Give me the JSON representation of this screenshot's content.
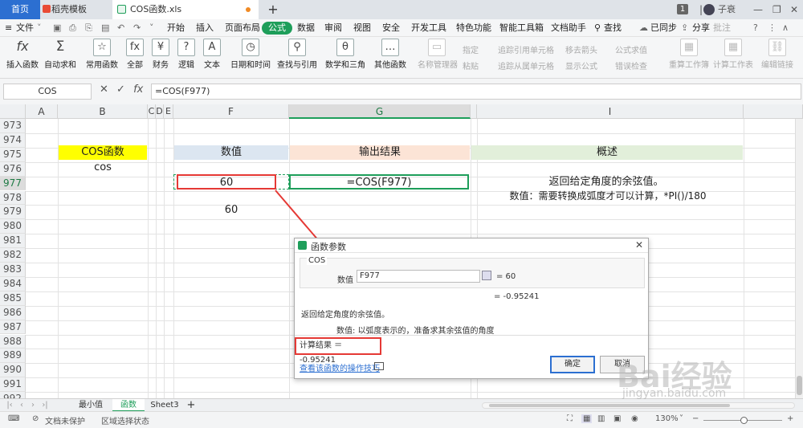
{
  "titlebar": {
    "home_tab": "首页",
    "template_tab": "稻壳模板",
    "file_tab": "COS函数.xls",
    "page_badge": "1",
    "user_name": "子衰"
  },
  "menubar": {
    "file_menu": "文件",
    "items": [
      "开始",
      "插入",
      "页面布局",
      "公式",
      "数据",
      "审阅",
      "视图",
      "安全",
      "开发工具",
      "特色功能",
      "智能工具箱",
      "文档助手"
    ],
    "search": "查找",
    "sync": "已同步",
    "share": "分享",
    "annotate": "批注"
  },
  "ribbon": {
    "insert_function": "插入函数",
    "autosum": "自动求和",
    "common_functions": "常用函数",
    "all": "全部",
    "finance": "财务",
    "logic": "逻辑",
    "text": "文本",
    "datetime": "日期和时间",
    "lookup": "查找与引用",
    "math": "数学和三角",
    "other": "其他函数",
    "name_manager": "名称管理器",
    "specify": "指定",
    "paste": "粘贴",
    "trace_precedents": "追踪引用单元格",
    "trace_dependents": "追踪从属单元格",
    "remove_arrows": "移去箭头",
    "show_formulas": "显示公式",
    "formula_eval": "公式求值",
    "error_check": "错误检查",
    "recalc_workbook": "重算工作簿",
    "calc_sheet": "计算工作表",
    "edit_links": "编辑链接"
  },
  "formula_bar": {
    "name_box": "COS",
    "fx": "fx",
    "formula": "=COS(F977)"
  },
  "grid": {
    "columns": [
      "A",
      "B",
      "C",
      "D",
      "E",
      "F",
      "G",
      "H",
      "I"
    ],
    "rows": [
      "973",
      "974",
      "975",
      "976",
      "977",
      "978",
      "979",
      "980",
      "981",
      "982",
      "983",
      "984",
      "985",
      "986",
      "987",
      "988",
      "989",
      "990",
      "991",
      "992"
    ],
    "b975": "COS函数",
    "b976": "cos",
    "f975": "数值",
    "g975": "输出结果",
    "i975": "概述",
    "f977": "60",
    "g977": "=COS(F977)",
    "i977": "返回给定角度的余弦值。",
    "i978": "数值：需要转换成弧度才可以计算，*PI()/180",
    "f979": "60"
  },
  "dialog": {
    "title": "函数参数",
    "function_name": "COS",
    "arg_label": "数值",
    "arg_value": "F977",
    "arg_result": "= 60",
    "func_result": "= -0.95241",
    "description": "返回给定角度的余弦值。",
    "arg_desc_label": "数值:",
    "arg_desc": "以弧度表示的，准备求其余弦值的角度",
    "calc_result": "计算结果 ＝ -0.95241",
    "help_link": "查看该函数的操作技巧",
    "ok": "确定",
    "cancel": "取消"
  },
  "sheets": {
    "tabs": [
      "最小值",
      "函数",
      "Sheet3"
    ],
    "active": "函数"
  },
  "status": {
    "protect": "文档未保护",
    "region": "区域选择状态",
    "zoom": "130%"
  },
  "watermark": {
    "brand": "Bai经验",
    "url": "jingyan.baidu.com"
  },
  "colors": {
    "accent": "#1e9e5a",
    "yellow": "#ffff00",
    "blue_header": "#dce6f1",
    "peach_header": "#fce4d6",
    "green_header": "#e2efda",
    "red_box": "#e53935"
  }
}
